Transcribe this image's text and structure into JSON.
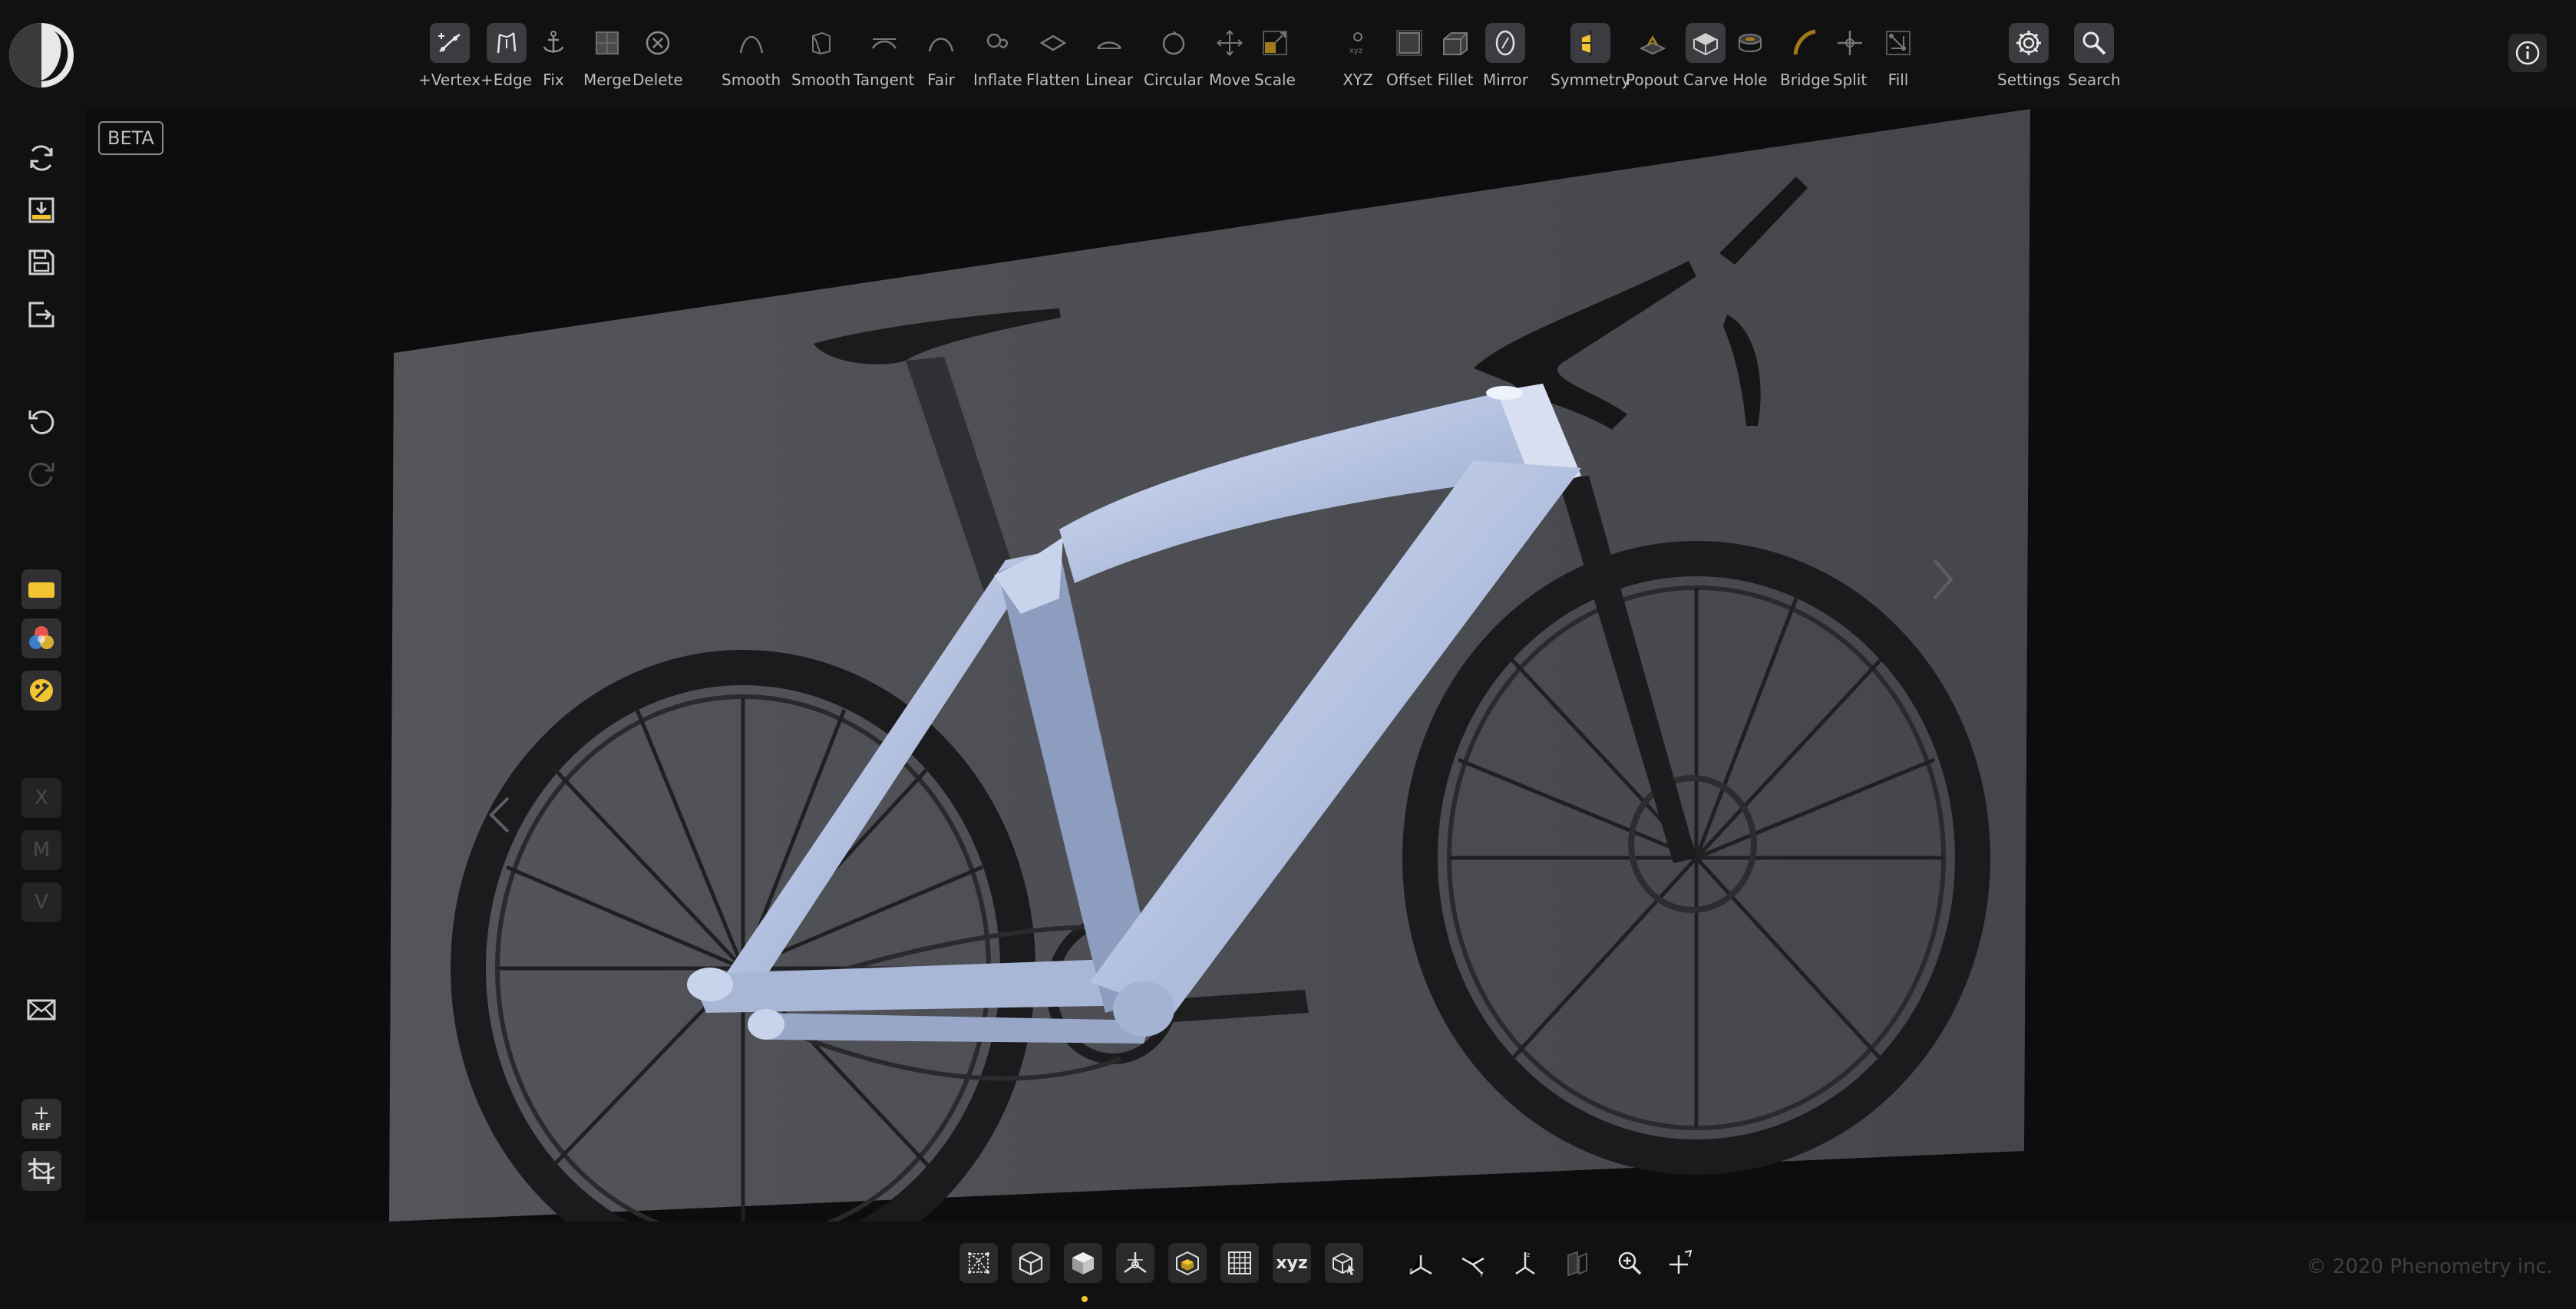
{
  "top_toolbar": {
    "groups": {
      "edit": [
        {
          "label": "+Vertex",
          "icon": "add-vertex-icon"
        },
        {
          "label": "+Edge",
          "icon": "add-edge-icon"
        },
        {
          "label": "Fix",
          "icon": "anchor-icon"
        },
        {
          "label": "Merge",
          "icon": "merge-icon"
        },
        {
          "label": "Delete",
          "icon": "delete-icon"
        }
      ],
      "shape": [
        {
          "label": "Smooth",
          "icon": "smooth-curve-icon"
        },
        {
          "label": "Smooth",
          "icon": "smooth-surface-icon"
        },
        {
          "label": "Tangent",
          "icon": "tangent-icon"
        },
        {
          "label": "Fair",
          "icon": "fair-icon"
        },
        {
          "label": "Inflate",
          "icon": "inflate-icon"
        },
        {
          "label": "Flatten",
          "icon": "flatten-icon"
        },
        {
          "label": "Linear",
          "icon": "linear-icon"
        },
        {
          "label": "Circular",
          "icon": "circular-icon"
        },
        {
          "label": "Move",
          "icon": "move-icon"
        },
        {
          "label": "Scale",
          "icon": "scale-icon"
        }
      ],
      "transform": [
        {
          "label": "XYZ",
          "icon": "xyz-icon"
        },
        {
          "label": "Offset",
          "icon": "offset-icon"
        },
        {
          "label": "Fillet",
          "icon": "fillet-icon"
        },
        {
          "label": "Mirror",
          "icon": "mirror-icon"
        },
        {
          "label": "Symmetry",
          "icon": "symmetry-icon"
        }
      ],
      "topology": [
        {
          "label": "Popout",
          "icon": "popout-icon"
        },
        {
          "label": "Carve",
          "icon": "carve-icon"
        },
        {
          "label": "Hole",
          "icon": "hole-icon"
        },
        {
          "label": "Bridge",
          "icon": "bridge-icon"
        },
        {
          "label": "Split",
          "icon": "split-icon"
        },
        {
          "label": "Fill",
          "icon": "fill-icon"
        }
      ],
      "app": [
        {
          "label": "Settings",
          "icon": "gear-icon"
        },
        {
          "label": "Search",
          "icon": "search-icon"
        }
      ]
    }
  },
  "left_toolbar": {
    "items": [
      {
        "name": "sync-icon"
      },
      {
        "name": "import-icon"
      },
      {
        "name": "save-icon"
      },
      {
        "name": "export-icon"
      },
      {
        "name": "undo-icon"
      },
      {
        "name": "redo-icon"
      },
      {
        "name": "yellow-material-icon"
      },
      {
        "name": "color-wheel-icon"
      },
      {
        "name": "paint-palette-icon"
      }
    ],
    "letter_buttons": [
      "X",
      "M",
      "V"
    ],
    "ref_label": "REF"
  },
  "viewport": {
    "badge": "BETA"
  },
  "bottom_toolbar": {
    "xyz_label": "xyz"
  },
  "footer": {
    "copyright": "© 2020 Phenometry inc."
  },
  "colors": {
    "accent": "#f3c431",
    "frame": "#b6c4e2",
    "background": "#111112",
    "reference_plane": "#4a4b51"
  }
}
